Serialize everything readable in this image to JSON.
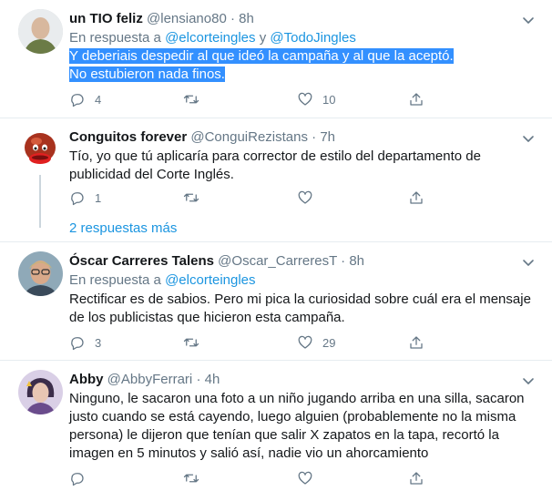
{
  "tweets": [
    {
      "name": "un TIO feliz",
      "handle": "@lensiano80",
      "dot": "·",
      "time": "8h",
      "reply_prefix": "En respuesta a",
      "reply_mention_1": "@elcorteingles",
      "reply_and": "y",
      "reply_mention_2": "@TodoJingles",
      "text_line_1": "Y deberiais despedir al que ideó la campaña y al que la aceptó.",
      "text_line_2": "No estubieron nada finos.",
      "replies": "4",
      "retweets": "",
      "likes": "10"
    },
    {
      "name": "Conguitos forever",
      "handle": "@ConguiRezistans",
      "dot": "·",
      "time": "7h",
      "text": "Tío, yo que tú aplicaría para corrector de estilo del departamento de publicidad del Corte Inglés.",
      "replies": "1",
      "retweets": "",
      "likes": "",
      "more_replies": "2 respuestas más"
    },
    {
      "name": "Óscar Carreres Talens",
      "handle": "@Oscar_CarreresT",
      "dot": "·",
      "time": "8h",
      "reply_prefix": "En respuesta a",
      "reply_mention_1": "@elcorteingles",
      "text": "Rectificar es de sabios. Pero mi pica la curiosidad sobre cuál era el mensaje de los publicistas que hicieron esta campaña.",
      "replies": "3",
      "retweets": "",
      "likes": "29"
    },
    {
      "name": "Abby",
      "handle": "@AbbyFerrari",
      "dot": "·",
      "time": "4h",
      "text": "Ninguno, le sacaron una foto a un niño jugando arriba en una silla, sacaron justo cuando se está cayendo, luego alguien (probablemente no la misma persona) le dijeron que tenían que salir X zapatos en la tapa, recortó la imagen en 5 minutos y salió así, nadie vio un ahorcamiento",
      "replies": "",
      "retweets": "",
      "likes": ""
    }
  ],
  "icons": {
    "reply": "reply-icon",
    "retweet": "retweet-icon",
    "like": "heart-icon",
    "share": "share-icon",
    "more": "chevron-down-icon"
  },
  "colors": {
    "accent": "#1b95e0",
    "secondary_text": "#657786",
    "selection": "#3390ff",
    "divider": "#e6ecf0"
  }
}
